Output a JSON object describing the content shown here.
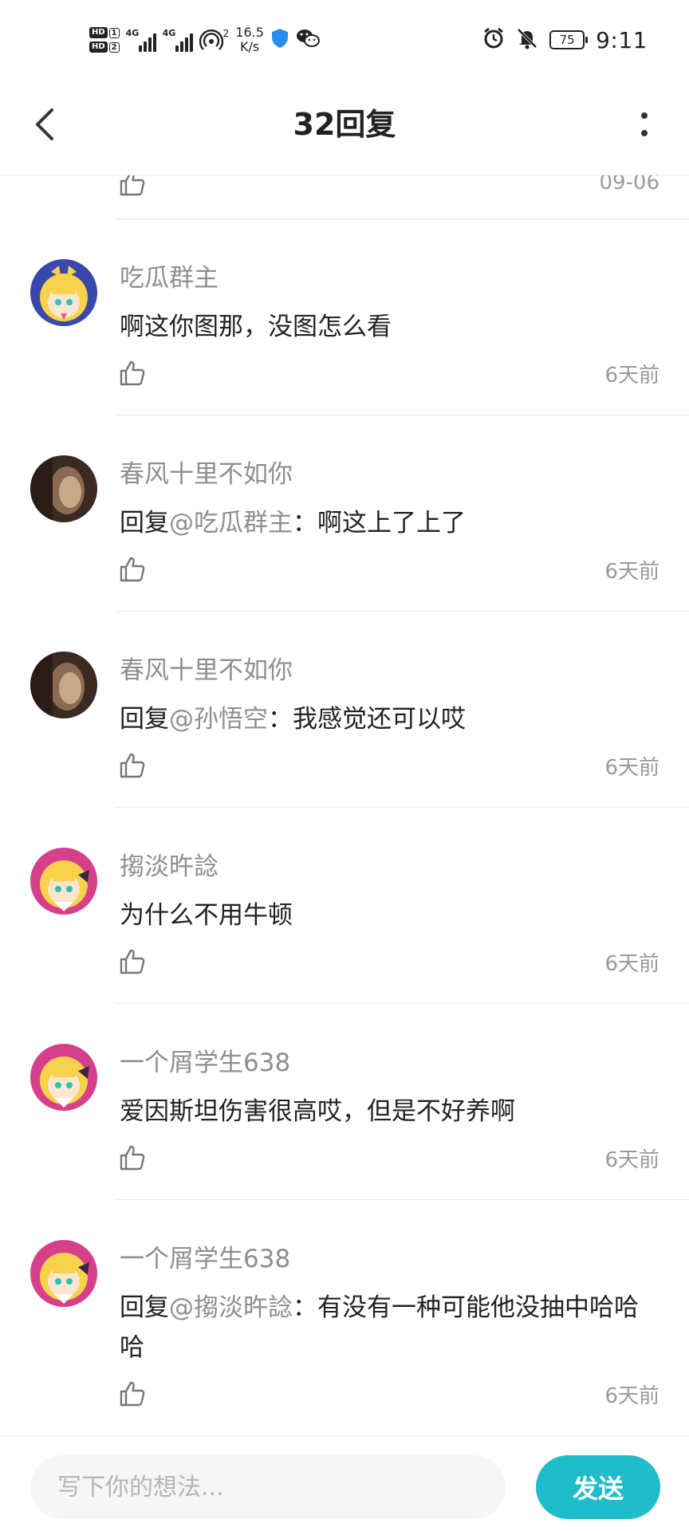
{
  "status_bar": {
    "sim1": "1",
    "sim2": "2",
    "hd_label": "HD",
    "network1": "4G",
    "network2": "4G",
    "hotspot_count": "2",
    "net_speed_value": "16.5",
    "net_speed_unit": "K/s",
    "battery": "75",
    "time": "9:11",
    "icons": [
      "signal-icon",
      "hotspot-icon",
      "shield-icon",
      "wechat-icon",
      "alarm-icon",
      "mute-bell-icon",
      "battery-icon"
    ],
    "accent_shield": "#2b8cf0"
  },
  "nav": {
    "title": "32回复",
    "back_icon": "back-arrow-icon",
    "more_icon": "more-vertical-icon"
  },
  "partial_item": {
    "time": "09-06"
  },
  "comments": [
    {
      "name": "吃瓜群主",
      "reply_prefix": "",
      "mention": "",
      "text": "啊这你图那，没图怎么看",
      "time": "6天前",
      "avatar": "anime-avatar-blue"
    },
    {
      "name": "春风十里不如你",
      "reply_prefix": "回复",
      "mention": "@吃瓜群主",
      "text": "：啊这上了上了",
      "time": "6天前",
      "avatar": "photo-avatar-dark"
    },
    {
      "name": "春风十里不如你",
      "reply_prefix": "回复",
      "mention": "@孙悟空",
      "text": "：我感觉还可以哎",
      "time": "6天前",
      "avatar": "photo-avatar-dark"
    },
    {
      "name": "搊淡旿諗",
      "reply_prefix": "",
      "mention": "",
      "text": "为什么不用牛顿",
      "time": "6天前",
      "avatar": "anime-avatar-pink"
    },
    {
      "name": "一个屑学生638",
      "reply_prefix": "",
      "mention": "",
      "text": "爱因斯坦伤害很高哎，但是不好养啊",
      "time": "6天前",
      "avatar": "anime-avatar-pink"
    },
    {
      "name": "一个屑学生638",
      "reply_prefix": "回复",
      "mention": "@搊淡旿諗",
      "text": "：有没有一种可能他没抽中哈哈哈",
      "time": "6天前",
      "avatar": "anime-avatar-pink"
    }
  ],
  "input": {
    "placeholder": "写下你的想法...",
    "value": "",
    "send_label": "发送"
  },
  "colors": {
    "send_button": "#1ebdc9",
    "name_text": "#8f8f8f",
    "body_text": "#222222",
    "divider": "#e8e8e8"
  }
}
